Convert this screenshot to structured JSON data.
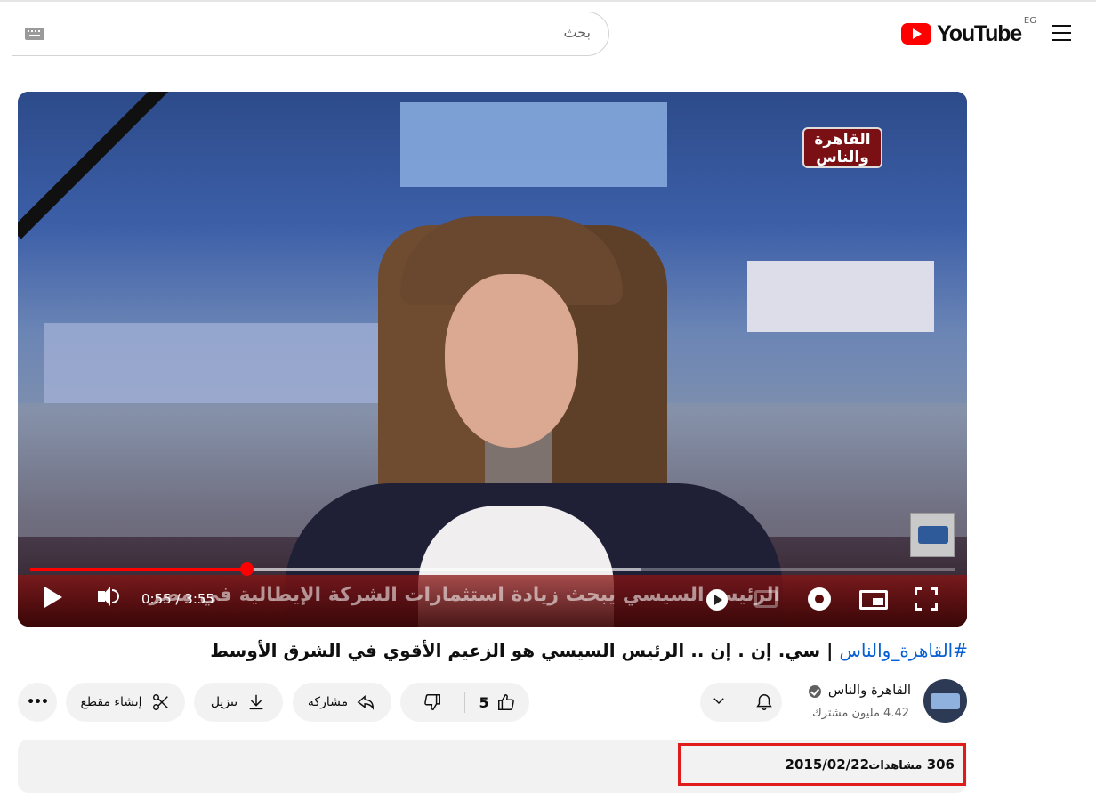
{
  "header": {
    "logo_text": "YouTube",
    "region": "EG",
    "search_placeholder": "بحث"
  },
  "player": {
    "channel_bug": "القاهرة والناس",
    "ticker": "الرئيس السيسي يبحث زيادة استثمارات الشركة الإيطالية في مصر",
    "time_current": "0:55",
    "time_total": "3:55",
    "progress_fraction": 0.234,
    "buffered_fraction": 0.66
  },
  "video": {
    "hashtag": "#القاهرة_والناس",
    "title_text": "| سي. إن . إن .. الرئيس السيسي هو الزعيم الأقوي في الشرق الأوسط"
  },
  "channel": {
    "name": "القاهرة والناس",
    "subscribers": "4.42 مليون مشترك"
  },
  "actions": {
    "like_count": "5",
    "share_label": "مشاركة",
    "download_label": "تنزيل",
    "clip_label": "إنشاء مقطع",
    "more_label": "•••"
  },
  "description": {
    "views": "306",
    "views_label": "مشاهدات",
    "date": "2015/02/22"
  },
  "colors": {
    "brand_red": "#ff0000",
    "highlight_box": "#e01b1b",
    "link_blue": "#065fd4"
  }
}
